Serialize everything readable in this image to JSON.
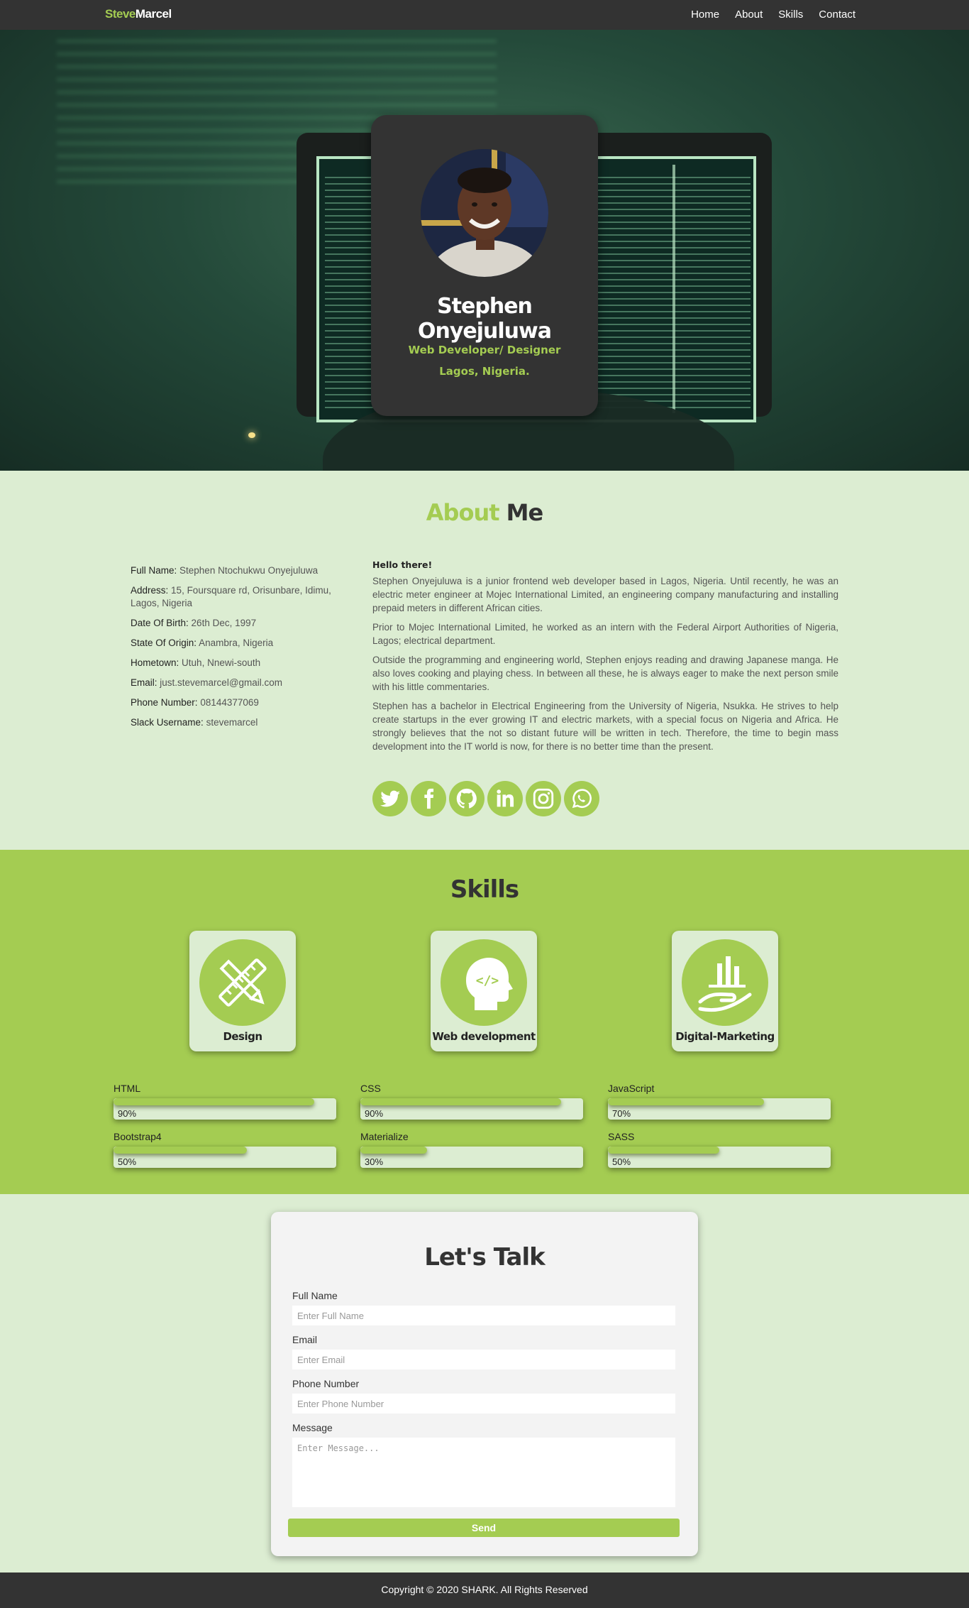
{
  "navbar": {
    "brand_part1": "Steve",
    "brand_part2": "Marcel",
    "links": [
      "Home",
      "About",
      "Skills",
      "Contact"
    ]
  },
  "hero": {
    "name": "Stephen Onyejuluwa",
    "role": "Web Developer/ Designer",
    "location": "Lagos, Nigeria."
  },
  "about": {
    "title_part1": "About",
    "title_part2": "Me",
    "details": [
      {
        "key": "Full Name:",
        "value": "Stephen Ntochukwu Onyejuluwa"
      },
      {
        "key": "Address:",
        "value": "15, Foursquare rd, Orisunbare, Idimu, Lagos, Nigeria"
      },
      {
        "key": "Date Of Birth:",
        "value": "26th Dec, 1997"
      },
      {
        "key": "State Of Origin:",
        "value": "Anambra, Nigeria"
      },
      {
        "key": "Hometown:",
        "value": "Utuh, Nnewi-south"
      },
      {
        "key": "Email:",
        "value": "just.stevemarcel@gmail.com"
      },
      {
        "key": "Phone Number:",
        "value": "08144377069"
      },
      {
        "key": "Slack Username:",
        "value": "stevemarcel"
      }
    ],
    "hello": "Hello there!",
    "paragraphs": [
      "Stephen Onyejuluwa is a junior frontend web developer based in Lagos, Nigeria. Until recently, he was an electric meter engineer at Mojec International Limited, an engineering company manufacturing and installing prepaid meters in different African cities.",
      "Prior to Mojec International Limited, he worked as an intern with the Federal Airport Authorities of Nigeria, Lagos; electrical department.",
      "Outside the programming and engineering world, Stephen enjoys reading and drawing Japanese manga. He also loves cooking and playing chess. In between all these, he is always eager to make the next person smile with his little commentaries.",
      "Stephen has a bachelor in Electrical Engineering from the University of Nigeria, Nsukka. He strives to help create startups in the ever growing IT and electric markets, with a special focus on Nigeria and Africa. He strongly believes that the not so distant future will be written in tech. Therefore, the time to begin mass development into the IT world is now, for there is no better time than the present."
    ],
    "socials": [
      "twitter-icon",
      "facebook-icon",
      "github-icon",
      "linkedin-icon",
      "instagram-icon",
      "whatsapp-icon"
    ]
  },
  "skills": {
    "title": "Skills",
    "cards": [
      {
        "label": "Design",
        "icon": "design-tools-icon"
      },
      {
        "label": "Web development",
        "icon": "code-head-icon"
      },
      {
        "label": "Digital-Marketing",
        "icon": "hand-chart-icon"
      }
    ],
    "bars": [
      {
        "name": "HTML",
        "pct_label": "90%",
        "fill": 0.9
      },
      {
        "name": "CSS",
        "pct_label": "90%",
        "fill": 0.9
      },
      {
        "name": "JavaScript",
        "pct_label": "70%",
        "fill": 0.7
      },
      {
        "name": "Bootstrap4",
        "pct_label": "50%",
        "fill": 0.6
      },
      {
        "name": "Materialize",
        "pct_label": "30%",
        "fill": 0.3
      },
      {
        "name": "SASS",
        "pct_label": "50%",
        "fill": 0.5
      }
    ],
    "accent_color": "#a4cc52"
  },
  "contact": {
    "title": "Let's Talk",
    "full_name_label": "Full Name",
    "full_name_placeholder": "Enter Full Name",
    "email_label": "Email",
    "email_placeholder": "Enter Email",
    "phone_label": "Phone Number",
    "phone_placeholder": "Enter Phone Number",
    "message_label": "Message",
    "message_placeholder": "Enter Message...",
    "send_label": "Send"
  },
  "footer": {
    "text": "Copyright © 2020 SHARK. All Rights Reserved"
  }
}
